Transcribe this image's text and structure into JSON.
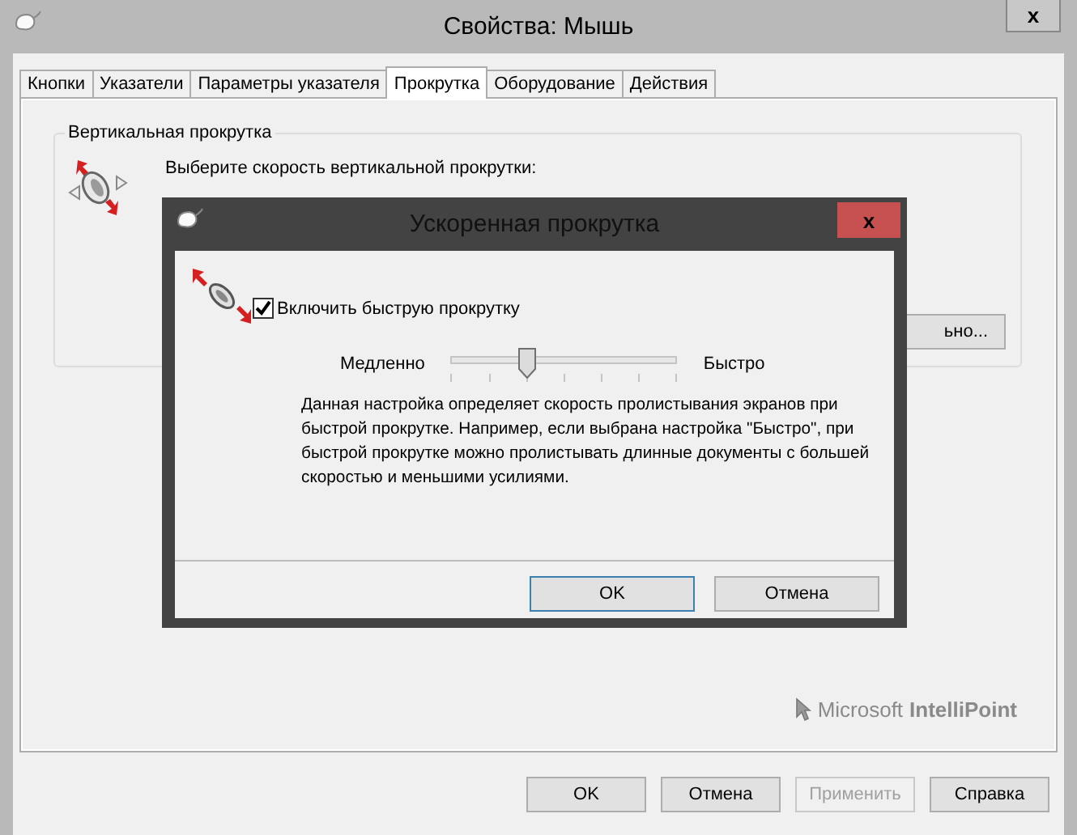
{
  "window": {
    "title": "Свойства: Мышь",
    "close": "x"
  },
  "tabs": [
    {
      "label": "Кнопки",
      "selected": false
    },
    {
      "label": "Указатели",
      "selected": false
    },
    {
      "label": "Параметры указателя",
      "selected": false
    },
    {
      "label": "Прокрутка",
      "selected": true
    },
    {
      "label": "Оборудование",
      "selected": false
    },
    {
      "label": "Действия",
      "selected": false
    }
  ],
  "vertical_scroll": {
    "title": "Вертикальная прокрутка",
    "prompt": "Выберите скорость вертикальной прокрутки:",
    "button": "ьно..."
  },
  "brand": {
    "vendor": "Microsoft",
    "product": "IntelliPoint"
  },
  "buttons": [
    {
      "label": "OK",
      "disabled": false
    },
    {
      "label": "Отмена",
      "disabled": false
    },
    {
      "label": "Применить",
      "disabled": true
    },
    {
      "label": "Справка",
      "disabled": false
    }
  ],
  "dialog": {
    "title": "Ускоренная прокрутка",
    "close": "x",
    "checkbox": {
      "label": "Включить быструю прокрутку",
      "checked": true
    },
    "slider": {
      "min_label": "Медленно",
      "max_label": "Быстро",
      "level": 0.33
    },
    "description": "Данная настройка определяет скорость пролистывания экранов при быстрой прокрутке. Например, если выбрана настройка \"Быстро\", при быстрой прокрутке можно пролистывать длинные документы с большей скоростью и меньшими усилиями.",
    "buttons": [
      "OK",
      "Отмена"
    ]
  }
}
